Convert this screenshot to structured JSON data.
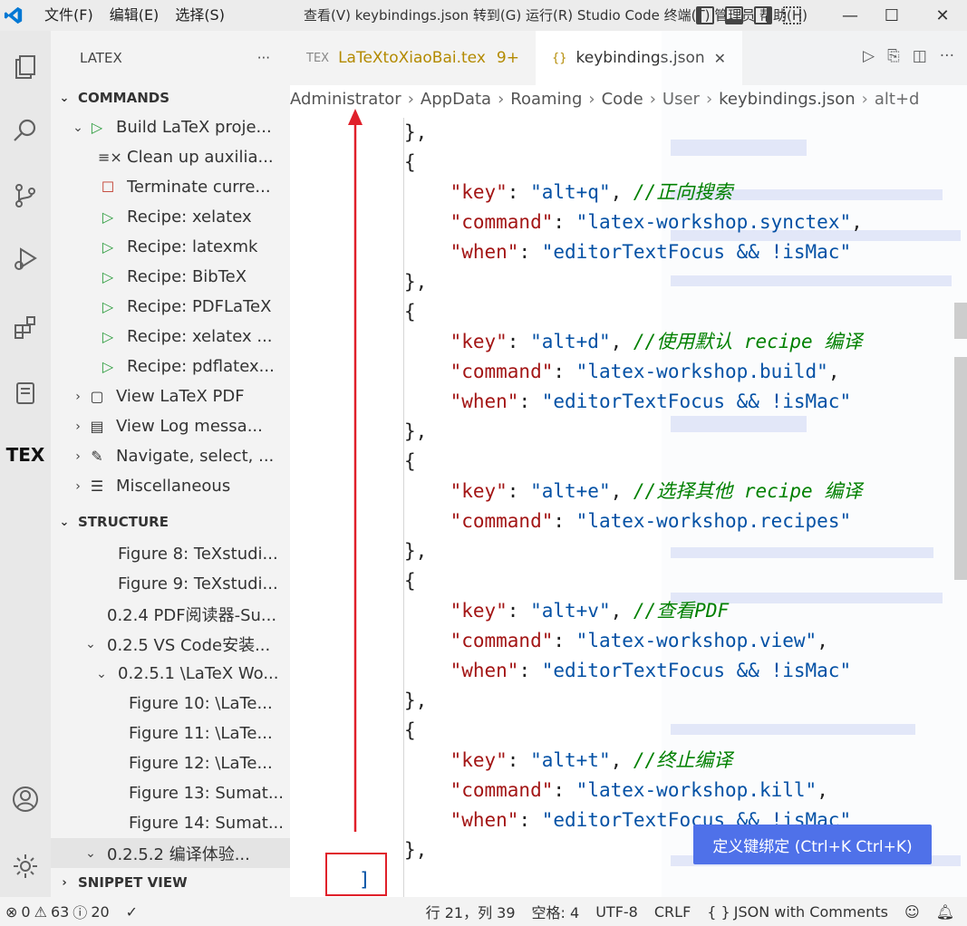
{
  "titlebar": {
    "menu": [
      "文件(F)",
      "编辑(E)",
      "选择(S)"
    ],
    "window_title": "查看(V)  keybindings.json  转到(G)  运行(R)  Studio Code  终端(T)  管理员  帮助(H)",
    "minimize": "—",
    "maximize": "☐",
    "close": "✕"
  },
  "activitybar": {
    "explorer_icon": "files-icon",
    "search_icon": "search-icon",
    "scm_icon": "source-control-icon",
    "run_icon": "run-debug-icon",
    "extensions_icon": "extensions-icon",
    "notes_icon": "book-icon",
    "tex_label": "TEX",
    "account_icon": "account-icon",
    "settings_icon": "gear-icon"
  },
  "sidebar": {
    "title": "LATEX",
    "more": "···",
    "commands_header": "COMMANDS",
    "commands": [
      {
        "label": "Build LaTeX proje...",
        "icon": "▷",
        "twisty": "⌄"
      },
      {
        "label": "Clean up auxilia...",
        "icon": "≡×",
        "twisty": ""
      },
      {
        "label": "Terminate curre...",
        "icon": "☐",
        "twisty": ""
      },
      {
        "label": "Recipe: xelatex",
        "icon": "▷",
        "twisty": ""
      },
      {
        "label": "Recipe: latexmk",
        "icon": "▷",
        "twisty": ""
      },
      {
        "label": "Recipe: BibTeX",
        "icon": "▷",
        "twisty": ""
      },
      {
        "label": "Recipe: PDFLaTeX",
        "icon": "▷",
        "twisty": ""
      },
      {
        "label": "Recipe: xelatex ...",
        "icon": "▷",
        "twisty": ""
      },
      {
        "label": "Recipe: pdflatex...",
        "icon": "▷",
        "twisty": ""
      },
      {
        "label": "View LaTeX PDF",
        "icon": "▢",
        "twisty": "›"
      },
      {
        "label": "View Log messa...",
        "icon": "▤",
        "twisty": "›"
      },
      {
        "label": "Navigate, select, ...",
        "icon": "✎",
        "twisty": "›"
      },
      {
        "label": "Miscellaneous",
        "icon": "☰",
        "twisty": "›"
      }
    ],
    "structure_header": "STRUCTURE",
    "structure": [
      {
        "label": "Figure 8: TeXstudi...",
        "twisty": ""
      },
      {
        "label": "Figure 9: TeXstudi...",
        "twisty": ""
      },
      {
        "label": "0.2.4 PDF阅读器-Su...",
        "twisty": ""
      },
      {
        "label": "0.2.5 VS Code安装...",
        "twisty": "⌄"
      },
      {
        "label": "0.2.5.1 \\LaTeX Wo...",
        "twisty": "⌄"
      },
      {
        "label": "Figure 10: \\LaTe...",
        "twisty": ""
      },
      {
        "label": "Figure 11: \\LaTe...",
        "twisty": ""
      },
      {
        "label": "Figure 12: \\LaTe...",
        "twisty": ""
      },
      {
        "label": "Figure 13: Sumat...",
        "twisty": ""
      },
      {
        "label": "Figure 14: Sumat...",
        "twisty": ""
      },
      {
        "label": "0.2.5.2 编译体验...",
        "twisty": "⌄"
      }
    ],
    "snippet_header": "SNIPPET VIEW"
  },
  "tabs": [
    {
      "label": "LaTeXtoXiaoBai.tex",
      "icon": "TEX",
      "modified": "9+",
      "active": false
    },
    {
      "label": "keybindings.json",
      "icon": "{}",
      "close": "✕",
      "active": true
    }
  ],
  "breadcrumb": [
    "Administrator",
    "AppData",
    "Roaming",
    "Code",
    "User",
    "keybindings.json",
    "alt+d"
  ],
  "code_lines": [
    [
      {
        "t": "p",
        "v": "},"
      }
    ],
    [
      {
        "t": "p",
        "v": "{"
      }
    ],
    [
      {
        "t": "k",
        "v": "    \"key\""
      },
      {
        "t": "p",
        "v": ": "
      },
      {
        "t": "s",
        "v": "\"alt+q\""
      },
      {
        "t": "p",
        "v": ", "
      },
      {
        "t": "c",
        "v": "//正向搜索"
      }
    ],
    [
      {
        "t": "k",
        "v": "    \"command\""
      },
      {
        "t": "p",
        "v": ": "
      },
      {
        "t": "s",
        "v": "\"latex-workshop.synctex\""
      },
      {
        "t": "p",
        "v": ","
      }
    ],
    [
      {
        "t": "k",
        "v": "    \"when\""
      },
      {
        "t": "p",
        "v": ": "
      },
      {
        "t": "s",
        "v": "\"editorTextFocus && !isMac\""
      }
    ],
    [
      {
        "t": "p",
        "v": "},"
      }
    ],
    [
      {
        "t": "p",
        "v": "{"
      }
    ],
    [
      {
        "t": "k",
        "v": "    \"key\""
      },
      {
        "t": "p",
        "v": ": "
      },
      {
        "t": "s",
        "v": "\"alt+d\""
      },
      {
        "t": "p",
        "v": ", "
      },
      {
        "t": "c",
        "v": "//使用默认 recipe 编译"
      }
    ],
    [
      {
        "t": "k",
        "v": "    \"command\""
      },
      {
        "t": "p",
        "v": ": "
      },
      {
        "t": "s",
        "v": "\"latex-workshop.build\""
      },
      {
        "t": "p",
        "v": ","
      }
    ],
    [
      {
        "t": "k",
        "v": "    \"when\""
      },
      {
        "t": "p",
        "v": ": "
      },
      {
        "t": "s",
        "v": "\"editorTextFocus && !isMac\""
      }
    ],
    [
      {
        "t": "p",
        "v": "},"
      }
    ],
    [
      {
        "t": "p",
        "v": "{"
      }
    ],
    [
      {
        "t": "k",
        "v": "    \"key\""
      },
      {
        "t": "p",
        "v": ": "
      },
      {
        "t": "s",
        "v": "\"alt+e\""
      },
      {
        "t": "p",
        "v": ", "
      },
      {
        "t": "c",
        "v": "//选择其他 recipe 编译"
      }
    ],
    [
      {
        "t": "k",
        "v": "    \"command\""
      },
      {
        "t": "p",
        "v": ": "
      },
      {
        "t": "s",
        "v": "\"latex-workshop.recipes\""
      }
    ],
    [
      {
        "t": "p",
        "v": "},"
      }
    ],
    [
      {
        "t": "p",
        "v": "{"
      }
    ],
    [
      {
        "t": "k",
        "v": "    \"key\""
      },
      {
        "t": "p",
        "v": ": "
      },
      {
        "t": "s",
        "v": "\"alt+v\""
      },
      {
        "t": "p",
        "v": ", "
      },
      {
        "t": "c",
        "v": "//查看PDF"
      }
    ],
    [
      {
        "t": "k",
        "v": "    \"command\""
      },
      {
        "t": "p",
        "v": ": "
      },
      {
        "t": "s",
        "v": "\"latex-workshop.view\""
      },
      {
        "t": "p",
        "v": ","
      }
    ],
    [
      {
        "t": "k",
        "v": "    \"when\""
      },
      {
        "t": "p",
        "v": ": "
      },
      {
        "t": "s",
        "v": "\"editorTextFocus && !isMac\""
      }
    ],
    [
      {
        "t": "p",
        "v": "},"
      }
    ],
    [
      {
        "t": "p",
        "v": "{"
      }
    ],
    [
      {
        "t": "k",
        "v": "    \"key\""
      },
      {
        "t": "p",
        "v": ": "
      },
      {
        "t": "s",
        "v": "\"alt+t\""
      },
      {
        "t": "p",
        "v": ", "
      },
      {
        "t": "c",
        "v": "//终止编译"
      }
    ],
    [
      {
        "t": "k",
        "v": "    \"command\""
      },
      {
        "t": "p",
        "v": ": "
      },
      {
        "t": "s",
        "v": "\"latex-workshop.kill\""
      },
      {
        "t": "p",
        "v": ","
      }
    ],
    [
      {
        "t": "k",
        "v": "    \"when\""
      },
      {
        "t": "p",
        "v": ": "
      },
      {
        "t": "s",
        "v": "\"editorTextFocus && !isMac\""
      }
    ],
    [
      {
        "t": "p",
        "v": "},"
      }
    ],
    [
      {
        "t": "s",
        "v": "]"
      }
    ]
  ],
  "define_keybinding_button": "定义键绑定 (Ctrl+K Ctrl+K)",
  "statusbar": {
    "errors": "0",
    "warnings": "63",
    "infos": "20",
    "check": "✓",
    "position": "行 21，列 39",
    "spaces": "空格: 4",
    "encoding": "UTF-8",
    "eol": "CRLF",
    "language_icon": "{ }",
    "language": "JSON with Comments"
  },
  "colors": {
    "accent_blue": "#4f71e9",
    "annotation_red": "#e0202a",
    "json_key": "#a31515",
    "json_string": "#0451a5",
    "comment": "#008000"
  }
}
